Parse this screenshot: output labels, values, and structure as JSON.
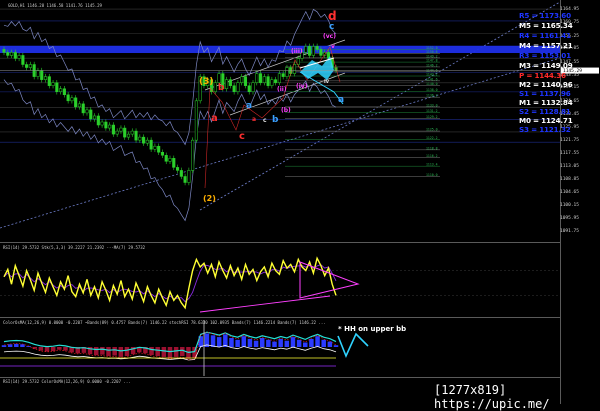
{
  "window": {
    "main_header": "GOLD,H1  1146.28 1146.58 1141.76 1145.29",
    "rsi_header": "RSI(14) 29.5732  Stk(5,3,3) 39.2227 21.2392  ---MA(7) 29.5732",
    "osc_header": "ColorOsMA(12,26,9) 0.0000 -0.2207 ~Bands(89) 0.4757 Bands(7) 1146.22 stochRSI 78.6330 102.0935 Bands(7) 1146.2214 Bands(7) 1146.22 ...",
    "bottom_header": "RSI(14) 29.5732  ColorOsMA(12,26,9) 0.0000 -0.2207 ..."
  },
  "levels": {
    "items": [
      {
        "label": "R5 = 1173.60",
        "color": "#1e35ff"
      },
      {
        "label": "M5 = 1165.34",
        "color": "#ffffff"
      },
      {
        "label": "R4 = 1161.41",
        "color": "#1e35ff"
      },
      {
        "label": "M4 = 1157.21",
        "color": "#ffffff"
      },
      {
        "label": "R3 = 1153.01",
        "color": "#1e35ff"
      },
      {
        "label": "M3 = 1149.09",
        "color": "#ffffff"
      },
      {
        "label": "P = 1144.36",
        "color": "#ff2a2a"
      },
      {
        "label": "M2 = 1140.96",
        "color": "#ffffff"
      },
      {
        "label": "S1 = 1137.96",
        "color": "#1e35ff"
      },
      {
        "label": "M1 = 1132.84",
        "color": "#ffffff"
      },
      {
        "label": "S2 = 1128.81",
        "color": "#1e35ff"
      },
      {
        "label": "M0 = 1124.71",
        "color": "#ffffff"
      },
      {
        "label": "S3 = 1121.32",
        "color": "#1e35ff"
      }
    ]
  },
  "wave_labels": {
    "d_top": "d",
    "c_top": "c",
    "vc": "(vc)",
    "iii": "(iii)",
    "v": "v",
    "three": "(3)",
    "b_mid": "b",
    "a_red": "a",
    "c_red": "c",
    "b_blue": "b",
    "a_blue": "a",
    "a_small": "a",
    "c_small": "c",
    "iv": "(iv)",
    "ii": "(ii)",
    "ib": "(b)",
    "iv_small": "iv",
    "a_right": "a",
    "two": "(2)"
  },
  "annotation": "* HH on upper bb",
  "watermark": "[1277x819] https://upic.me/",
  "chart_data": {
    "type": "line",
    "title": "GOLD,H1",
    "ohlc_header": {
      "open": 1146.28,
      "high": 1146.58,
      "low": 1141.76,
      "close": 1145.29
    },
    "y_ticks": [
      1164.95,
      1160.75,
      1156.25,
      1152.05,
      1147.55,
      1143.35,
      1139.15,
      1134.65,
      1130.45,
      1125.95,
      1121.75,
      1117.55,
      1113.05,
      1108.85,
      1104.65,
      1100.15,
      1095.95,
      1091.75
    ],
    "ylim": [
      1089.0,
      1167.0
    ],
    "grid": false,
    "close_series": {
      "name": "GOLD H1 close",
      "values": [
        1151,
        1150,
        1151,
        1149,
        1150,
        1147,
        1146,
        1147,
        1143,
        1145,
        1142,
        1143,
        1140,
        1141,
        1138,
        1139,
        1137,
        1135,
        1136,
        1133,
        1134,
        1131,
        1132,
        1129,
        1130,
        1127,
        1128,
        1126,
        1127,
        1124,
        1125,
        1126,
        1123,
        1124,
        1125,
        1122,
        1123,
        1121,
        1122,
        1119,
        1120,
        1118,
        1117,
        1115,
        1116,
        1113,
        1112,
        1110,
        1108,
        1112,
        1122,
        1135,
        1143,
        1140,
        1142,
        1138,
        1141,
        1144,
        1139,
        1142,
        1140,
        1138,
        1141,
        1143,
        1140,
        1138,
        1141,
        1144,
        1141,
        1143,
        1140,
        1142,
        1141,
        1144,
        1143,
        1146,
        1144,
        1147,
        1149,
        1151,
        1153,
        1150,
        1153,
        1152,
        1150,
        1151,
        1149,
        1146,
        1145
      ]
    },
    "pivot_levels": [
      1173.6,
      1165.34,
      1161.41,
      1157.21,
      1153.01,
      1149.09,
      1144.36,
      1140.96,
      1137.96,
      1132.84,
      1128.81,
      1124.71,
      1121.32
    ],
    "fib_levels": [
      1152.0,
      1150.6,
      1149.2,
      1147.8,
      1146.2,
      1144.6,
      1143.2,
      1141.6,
      1140.0,
      1138.0,
      1136.2,
      1133.0,
      1131.2,
      1129.2,
      1125.0,
      1122.2,
      1118.8,
      1116.2,
      1113.4,
      1110.0
    ],
    "rsi_panel": {
      "name": "RSI(14)",
      "value": 29.5732,
      "values": [
        60,
        72,
        48,
        78,
        62,
        45,
        70,
        55,
        38,
        66,
        50,
        35,
        58,
        44,
        30,
        52,
        40,
        62,
        36,
        28,
        48,
        34,
        56,
        30,
        44,
        26,
        52,
        38,
        22,
        46,
        32,
        54,
        28,
        40,
        24,
        50,
        36,
        20,
        44,
        30,
        18,
        40,
        26,
        14,
        36,
        22,
        30,
        18,
        10,
        42,
        70,
        88,
        76,
        82,
        66,
        80,
        60,
        84,
        70,
        58,
        78,
        62,
        74,
        56,
        80,
        64,
        72,
        54,
        68,
        76,
        60,
        82,
        70,
        64,
        86,
        74,
        80,
        68,
        88,
        76,
        70,
        84,
        66,
        90,
        78,
        62,
        74,
        48,
        30
      ]
    },
    "osc_panel": {
      "name": "ColorOsMA(12,26,9)",
      "values": [
        0.2,
        0.3,
        0.35,
        0.3,
        0.1,
        -0.2,
        -0.4,
        -0.5,
        -0.45,
        -0.3,
        -0.4,
        -0.6,
        -0.7,
        -0.65,
        -0.8,
        -0.9,
        -0.85,
        -1.0,
        -0.95,
        -1.1,
        -1.0,
        -0.8,
        -0.6,
        -0.7,
        -0.9,
        -1.0,
        -1.1,
        -1.2,
        -1.1,
        -1.0,
        -1.3,
        -1.2,
        1.2,
        1.5,
        1.3,
        1.1,
        1.4,
        1.0,
        0.8,
        1.2,
        0.9,
        0.7,
        1.0,
        0.8,
        0.6,
        0.9,
        0.7,
        1.1,
        0.8,
        0.5,
        0.9,
        1.2,
        0.8,
        0.6,
        0.2
      ]
    }
  }
}
